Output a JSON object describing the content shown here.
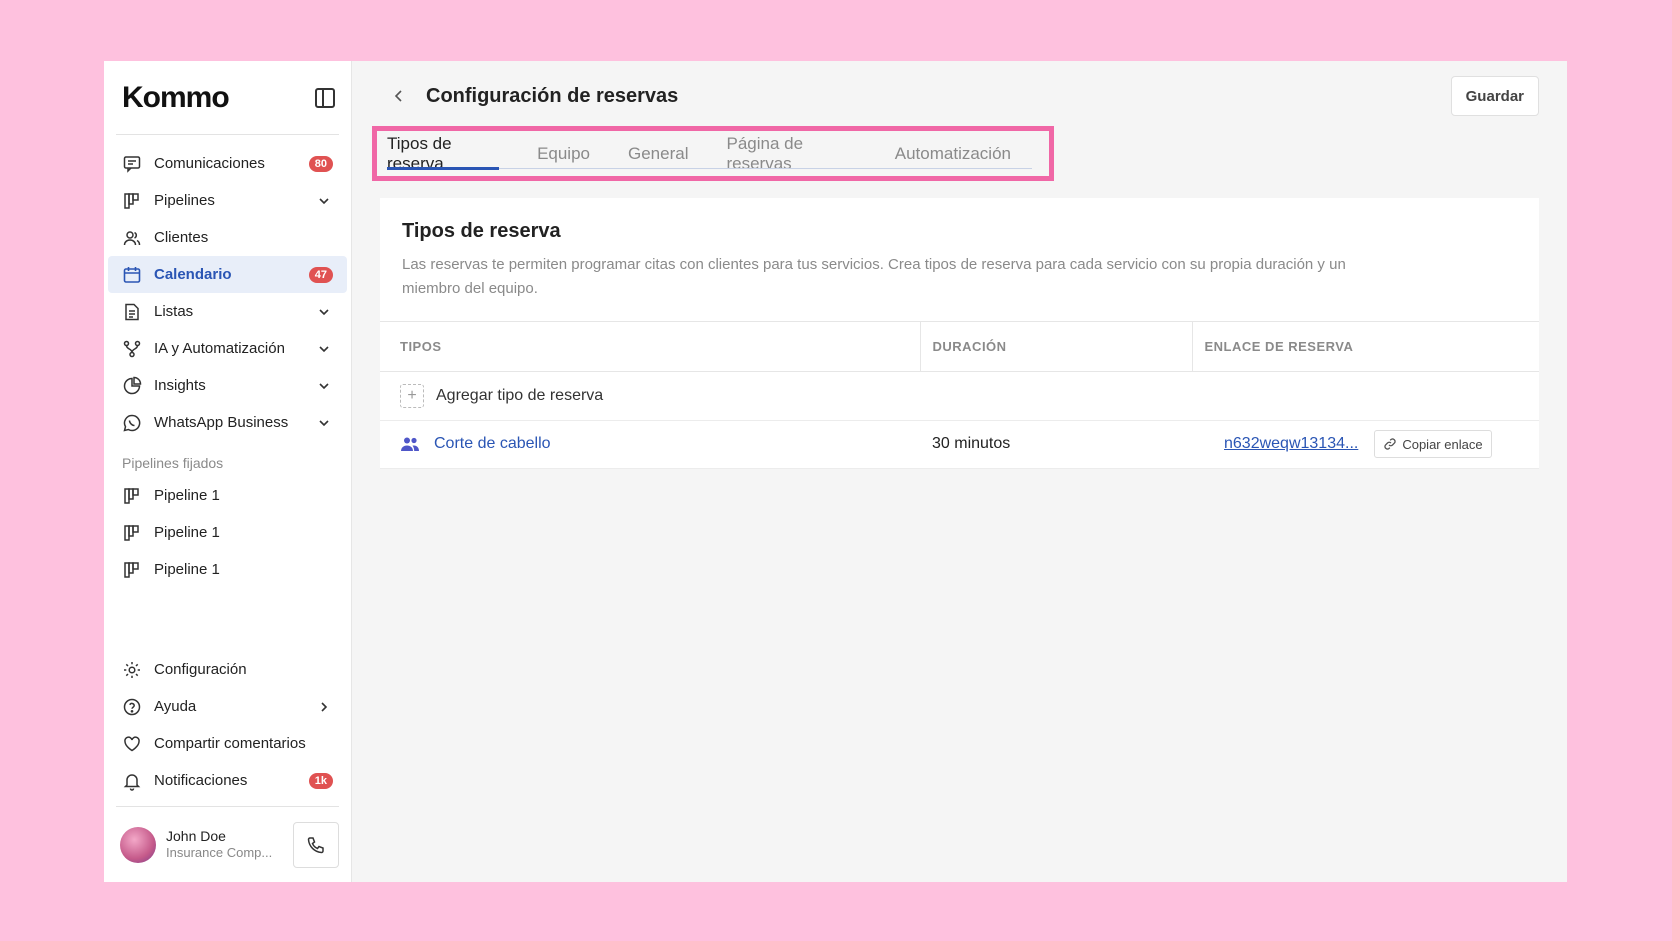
{
  "brand": {
    "logo": "Kommo"
  },
  "sidebar": {
    "items": [
      {
        "label": "Comunicaciones",
        "icon": "chat-icon",
        "badge": "80"
      },
      {
        "label": "Pipelines",
        "icon": "pipeline-icon",
        "chevron": "down"
      },
      {
        "label": "Clientes",
        "icon": "users-icon"
      },
      {
        "label": "Calendario",
        "icon": "calendar-icon",
        "badge": "47",
        "active": true
      },
      {
        "label": "Listas",
        "icon": "document-icon",
        "chevron": "down"
      },
      {
        "label": "IA y Automatización",
        "icon": "flow-icon",
        "chevron": "down"
      },
      {
        "label": "Insights",
        "icon": "pie-chart-icon",
        "chevron": "down"
      },
      {
        "label": "WhatsApp Business",
        "icon": "whatsapp-icon",
        "chevron": "down"
      }
    ],
    "pinned_title": "Pipelines fijados",
    "pinned": [
      {
        "label": "Pipeline 1"
      },
      {
        "label": "Pipeline 1"
      },
      {
        "label": "Pipeline 1"
      }
    ],
    "bottom": [
      {
        "label": "Configuración",
        "icon": "gear-icon"
      },
      {
        "label": "Ayuda",
        "icon": "help-icon",
        "chevron": "right"
      },
      {
        "label": "Compartir comentarios",
        "icon": "heart-icon"
      },
      {
        "label": "Notificaciones",
        "icon": "bell-icon",
        "badge": "1k"
      }
    ],
    "profile": {
      "name": "John Doe",
      "company": "Insurance Comp..."
    }
  },
  "header": {
    "title": "Configuración de reservas",
    "save_label": "Guardar"
  },
  "tabs": [
    {
      "label": "Tipos de reserva",
      "active": true
    },
    {
      "label": "Equipo"
    },
    {
      "label": "General"
    },
    {
      "label": "Página de reservas"
    },
    {
      "label": "Automatización"
    }
  ],
  "card": {
    "title": "Tipos de reserva",
    "description": "Las reservas te permiten programar citas con clientes para tus servicios. Crea tipos de reserva para cada servicio con su propia duración y un miembro del equipo.",
    "columns": [
      "TIPOS",
      "DURACIÓN",
      "ENLACE DE RESERVA"
    ],
    "add_label": "Agregar tipo de reserva",
    "rows": [
      {
        "type": "Corte de cabello",
        "duration": "30 minutos",
        "link": "n632weqw13134...",
        "copy_label": "Copiar enlace"
      }
    ]
  },
  "colors": {
    "accent": "#2a55b4",
    "highlight": "#f067a6",
    "badge": "#e05252",
    "background": "#fec1de"
  }
}
